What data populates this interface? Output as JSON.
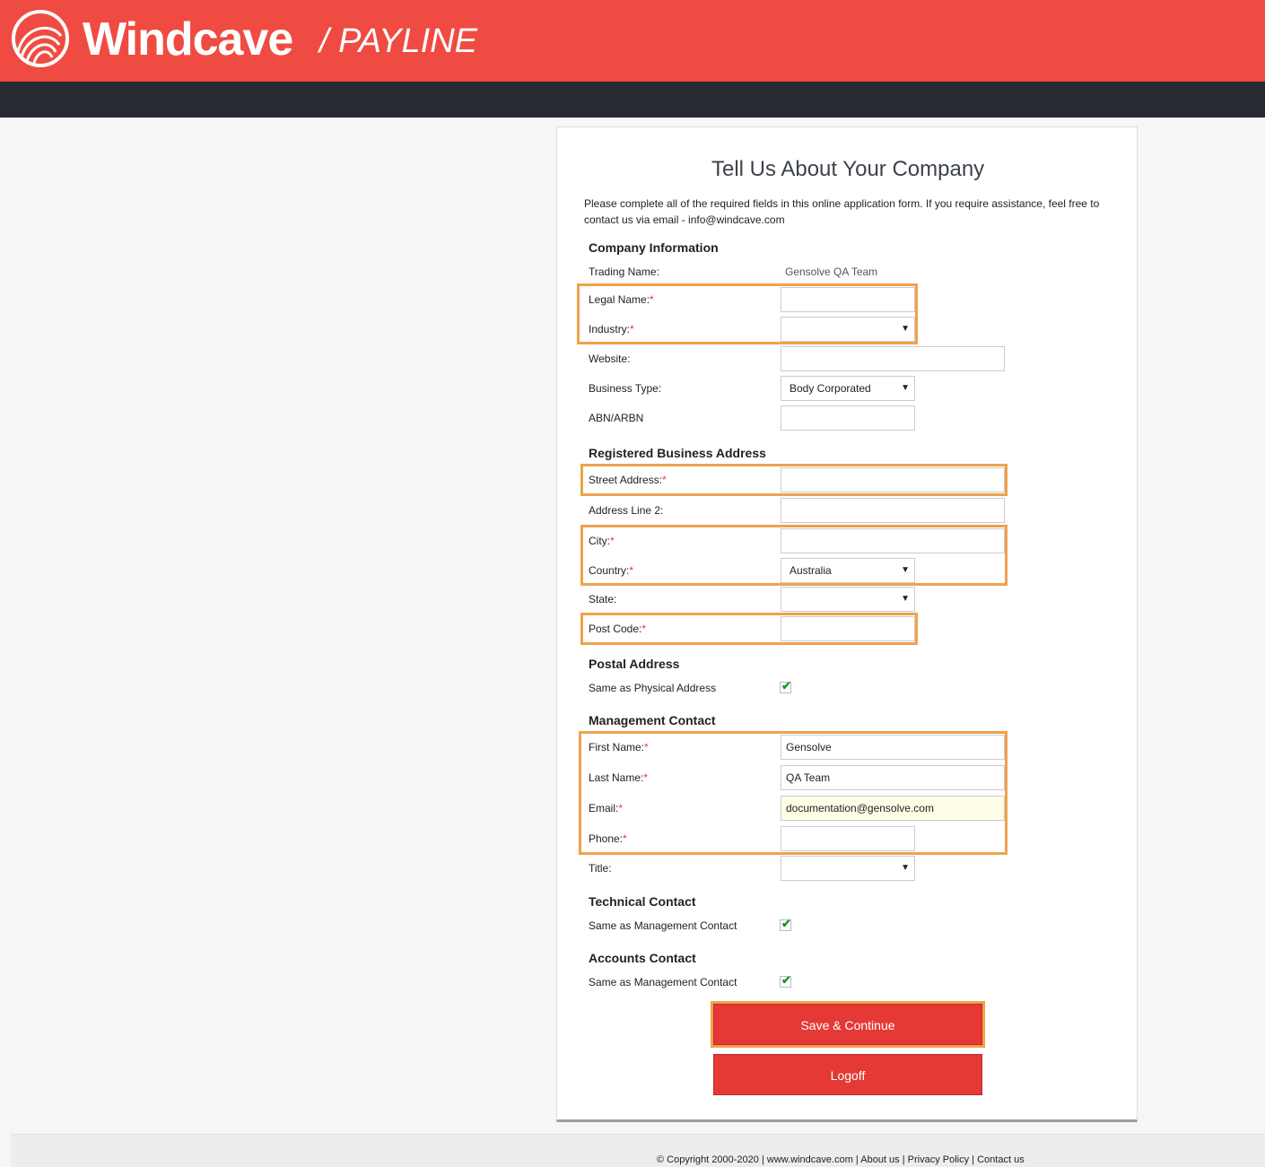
{
  "header": {
    "brand": "Windcave",
    "product": "/ PAYLINE"
  },
  "form": {
    "title": "Tell Us About Your Company",
    "intro": "Please complete all of the required fields in this online application form. If you require assistance, feel free to contact us via email - info@windcave.com",
    "required_marker": "*",
    "company": {
      "heading": "Company Information",
      "trading_name_label": "Trading Name:",
      "trading_name_value": "Gensolve QA Team",
      "legal_name_label": "Legal Name:",
      "legal_name_value": "",
      "industry_label": "Industry:",
      "industry_value": "",
      "website_label": "Website:",
      "website_value": "",
      "business_type_label": "Business Type:",
      "business_type_value": "Body Corporated",
      "abn_label": "ABN/ARBN",
      "abn_value": ""
    },
    "address": {
      "heading": "Registered Business Address",
      "street_label": "Street Address:",
      "street_value": "",
      "line2_label": "Address Line 2:",
      "line2_value": "",
      "city_label": "City:",
      "city_value": "",
      "country_label": "Country:",
      "country_value": "Australia",
      "state_label": "State:",
      "state_value": "",
      "postcode_label": "Post Code:",
      "postcode_value": ""
    },
    "postal": {
      "heading": "Postal Address",
      "same_label": "Same as Physical Address",
      "checked": true
    },
    "management": {
      "heading": "Management Contact",
      "first_name_label": "First Name:",
      "first_name_value": "Gensolve",
      "last_name_label": "Last Name:",
      "last_name_value": "QA Team",
      "email_label": "Email:",
      "email_value": "documentation@gensolve.com",
      "phone_label": "Phone:",
      "phone_value": "",
      "title_label": "Title:",
      "title_value": ""
    },
    "technical": {
      "heading": "Technical Contact",
      "same_label": "Same as Management Contact",
      "checked": true
    },
    "accounts": {
      "heading": "Accounts Contact",
      "same_label": "Same as Management Contact",
      "checked": true
    },
    "buttons": {
      "save": "Save & Continue",
      "logoff": "Logoff"
    }
  },
  "footer": {
    "copyright": "© Copyright 2000-2020",
    "site": "www.windcave.com",
    "about": "About us",
    "privacy": "Privacy Policy",
    "contact": "Contact us",
    "separator": " | "
  },
  "colors": {
    "brand_red": "#f04b42",
    "navbar": "#272a30",
    "button_red": "#e53935",
    "highlight": "#f0a24a",
    "check_green": "#1a9a1a"
  }
}
